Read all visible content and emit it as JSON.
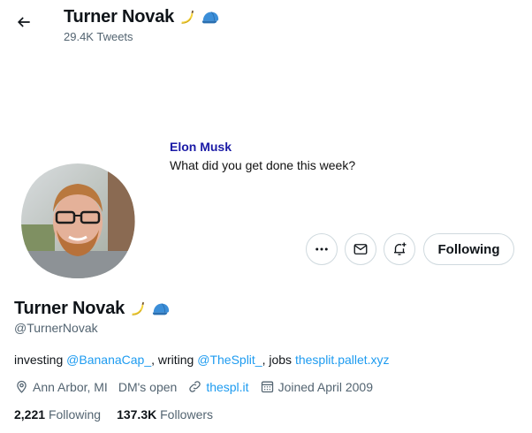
{
  "header": {
    "name": "Turner Novak",
    "tweet_count": "29.4K Tweets"
  },
  "banner": {
    "tweet_author": "Elon Musk",
    "tweet_text": "What did you get done this week?"
  },
  "actions": {
    "more_icon": "more-icon",
    "message_icon": "mail-icon",
    "notify_icon": "bell-plus-icon",
    "follow_label": "Following"
  },
  "profile": {
    "name": "Turner Novak",
    "emoji": [
      "banana-emoji",
      "blue-cap-emoji"
    ],
    "handle": "@TurnerNovak",
    "bio": {
      "t1": "investing ",
      "l1": "@BananaCap_",
      "t2": ", writing ",
      "l2": "@TheSplit_",
      "t3": ", jobs ",
      "l3": "thesplit.pallet.xyz"
    },
    "location": "Ann Arbor, MI",
    "dm_status": "DM's open",
    "website": "thespl.it",
    "joined": "Joined April 2009"
  },
  "stats": {
    "following_count": "2,221",
    "following_label": "Following",
    "followers_count": "137.3K",
    "followers_label": "Followers"
  },
  "colors": {
    "link": "#1d9bf0",
    "secondary_text": "#536471",
    "border": "#cfd9de",
    "tweet_author": "#1a1aa6"
  }
}
